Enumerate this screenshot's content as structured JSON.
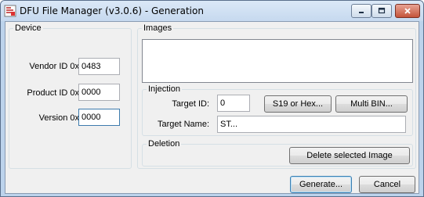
{
  "window": {
    "title": "DFU File Manager (v3.0.6) - Generation",
    "icons": {
      "app": "dfu-app-icon",
      "minimize": "minimize-icon",
      "maximize": "maximize-icon",
      "close": "close-icon"
    }
  },
  "device": {
    "legend": "Device",
    "vendor_label": "Vendor ID 0x",
    "vendor_value": "0483",
    "product_label": "Product ID 0x",
    "product_value": "0000",
    "version_label": "Version 0x",
    "version_value": "0000"
  },
  "images": {
    "legend": "Images"
  },
  "injection": {
    "legend": "Injection",
    "target_id_label": "Target ID:",
    "target_id_value": "0",
    "s19_button": "S19 or Hex...",
    "multibin_button": "Multi BIN...",
    "target_name_label": "Target Name:",
    "target_name_value": "ST..."
  },
  "deletion": {
    "legend": "Deletion",
    "delete_button": "Delete selected Image"
  },
  "footer": {
    "generate_button": "Generate...",
    "cancel_button": "Cancel"
  }
}
